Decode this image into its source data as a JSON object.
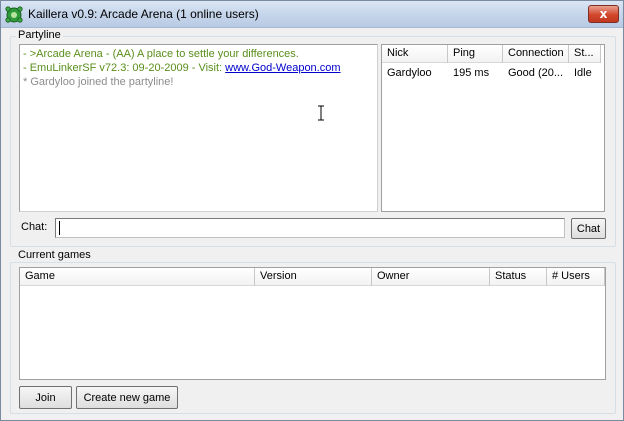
{
  "window": {
    "title": "Kaillera v0.9: Arcade Arena (1 online users)",
    "close_glyph": "x"
  },
  "partyline": {
    "label": "Partyline",
    "messages": [
      {
        "text": "- >Arcade Arena - (AA) A place to settle your differences.",
        "color": "#5a8f1c"
      },
      {
        "text_prefix": "- EmuLinkerSF v72.3: 09-20-2009 - Visit: ",
        "link": "www.God-Weapon.com",
        "color": "#5a8f1c",
        "link_color": "#0000cc"
      },
      {
        "text": "* Gardyloo joined the partyline!",
        "color": "#8c8c8c"
      }
    ]
  },
  "users": {
    "columns": [
      "Nick",
      "Ping",
      "Connection",
      "St..."
    ],
    "rows": [
      {
        "nick": "Gardyloo",
        "ping": "195 ms",
        "connection": "Good (20...",
        "status": "Idle"
      }
    ]
  },
  "chat": {
    "label": "Chat:",
    "value": "",
    "button": "Chat"
  },
  "games": {
    "label": "Current games",
    "columns": [
      "Game",
      "Version",
      "Owner",
      "Status",
      "# Users"
    ],
    "rows": []
  },
  "actions": {
    "join": "Join",
    "create": "Create new game"
  }
}
